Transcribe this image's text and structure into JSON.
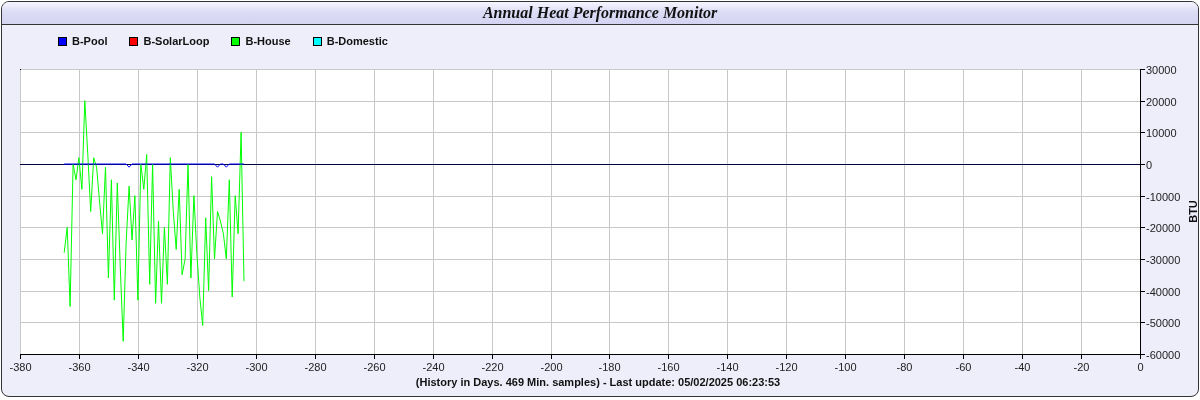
{
  "window": {
    "title": "Annual Heat Performance Monitor"
  },
  "chart_data": {
    "type": "line",
    "xlabel": "(History in Days. 469 Min. samples) - Last update: 05/02/2025 06:23:53",
    "ylabel": "BTU",
    "x": [
      -365,
      -364,
      -363,
      -362,
      -361,
      -360,
      -359,
      -358,
      -357,
      -356,
      -355,
      -354,
      -353,
      -352,
      -351,
      -350,
      -349,
      -348,
      -347,
      -346,
      -345,
      -344,
      -343,
      -342,
      -341,
      -340,
      -339,
      -338,
      -337,
      -336,
      -335,
      -334,
      -333,
      -332,
      -331,
      -330,
      -329,
      -328,
      -327,
      -326,
      -325,
      -324,
      -323,
      -322,
      -321,
      -320,
      -319,
      -318,
      -317,
      -316,
      -315,
      -314,
      -313,
      -312,
      -311,
      -310,
      -309,
      -308,
      -307,
      -306,
      -305,
      -304
    ],
    "series": [
      {
        "name": "B-Pool",
        "color": "#0000ff",
        "values": [
          0,
          0,
          0,
          0,
          0,
          0,
          0,
          0,
          0,
          0,
          0,
          0,
          0,
          0,
          0,
          0,
          0,
          0,
          0,
          0,
          0,
          0,
          -1000,
          0,
          0,
          0,
          0,
          0,
          0,
          0,
          0,
          0,
          0,
          0,
          0,
          0,
          0,
          0,
          0,
          0,
          0,
          0,
          0,
          0,
          0,
          0,
          0,
          0,
          0,
          0,
          0,
          0,
          -1000,
          0,
          0,
          -1000,
          0,
          0,
          0,
          0,
          0,
          0
        ]
      },
      {
        "name": "B-SolarLoop",
        "color": "#ff0000",
        "values": [
          null,
          null,
          null,
          null,
          null,
          null,
          null,
          null,
          null,
          null,
          null,
          null,
          null,
          null,
          null,
          null,
          null,
          null,
          null,
          null,
          null,
          null,
          null,
          null,
          null,
          null,
          null,
          null,
          null,
          null,
          null,
          null,
          null,
          null,
          null,
          null,
          null,
          null,
          null,
          null,
          null,
          null,
          null,
          null,
          null,
          null,
          null,
          null,
          null,
          null,
          null,
          null,
          null,
          null,
          null,
          null,
          null,
          null,
          null,
          null,
          null,
          null
        ]
      },
      {
        "name": "B-House",
        "color": "#00ff00",
        "values": [
          -28000,
          -20000,
          -45000,
          0,
          -5000,
          2000,
          -8000,
          20000,
          3000,
          -15000,
          2000,
          -1000,
          -12000,
          -22000,
          -1000,
          -36000,
          -5000,
          -43000,
          -6000,
          -32000,
          -56000,
          -25000,
          -7000,
          -24000,
          -10000,
          -43000,
          0,
          -8000,
          3000,
          -38000,
          0,
          -44000,
          -18000,
          -44000,
          -20000,
          -38000,
          2000,
          -15000,
          -27000,
          -8000,
          -35000,
          -30000,
          0,
          -36000,
          -10000,
          -28000,
          -42000,
          -51000,
          -17000,
          -40000,
          -4000,
          -30000,
          -15000,
          -18000,
          -22000,
          -30000,
          -5000,
          -42000,
          -10000,
          -22000,
          10000,
          -37000
        ]
      },
      {
        "name": "B-Domestic",
        "color": "#00ffff",
        "values": [
          null,
          null,
          null,
          null,
          null,
          null,
          null,
          null,
          null,
          null,
          null,
          null,
          null,
          null,
          null,
          null,
          null,
          null,
          null,
          null,
          null,
          null,
          null,
          null,
          null,
          null,
          null,
          null,
          null,
          null,
          null,
          null,
          null,
          null,
          null,
          null,
          null,
          null,
          null,
          null,
          null,
          null,
          null,
          null,
          null,
          null,
          null,
          null,
          null,
          null,
          null,
          null,
          null,
          null,
          null,
          null,
          null,
          null,
          null,
          null,
          null,
          null
        ]
      }
    ],
    "grid": true,
    "xlim": [
      -380,
      0
    ],
    "ylim": [
      -60000,
      30000
    ],
    "xticks": [
      -380,
      -360,
      -340,
      -320,
      -300,
      -280,
      -260,
      -240,
      -220,
      -200,
      -180,
      -160,
      -140,
      -120,
      -100,
      -80,
      -60,
      -40,
      -20,
      0
    ],
    "yticks": [
      -60000,
      -50000,
      -40000,
      -30000,
      -20000,
      -10000,
      0,
      10000,
      20000,
      30000
    ]
  }
}
